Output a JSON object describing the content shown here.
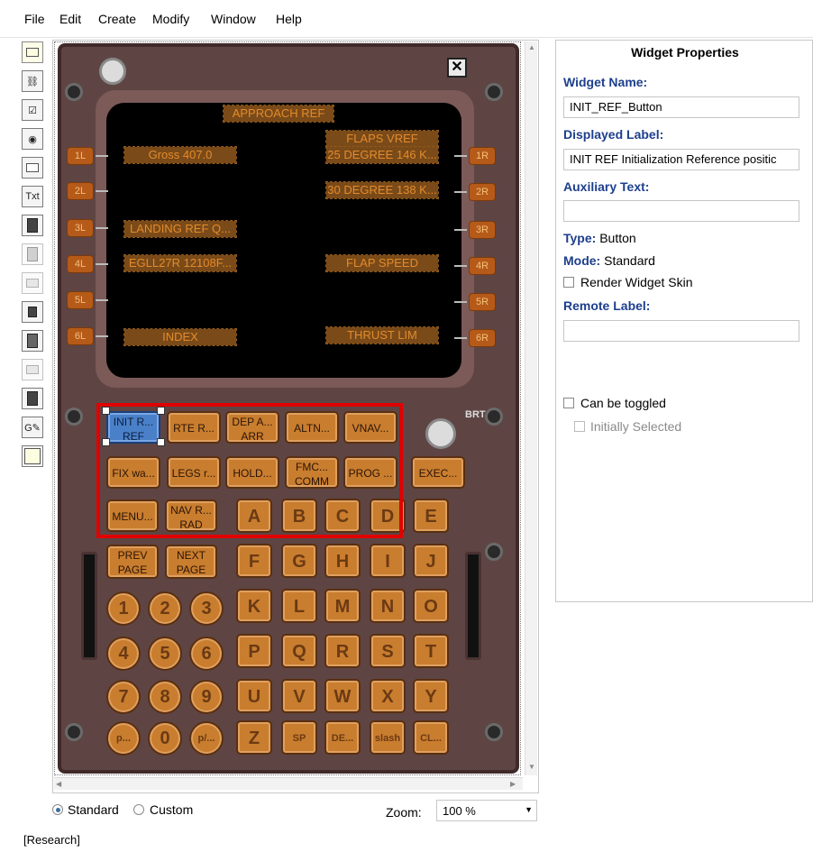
{
  "menu": [
    "File",
    "Edit",
    "Create",
    "Modify",
    "Window",
    "Help"
  ],
  "toolbar_icons": [
    "widget-rect-icon",
    "link-icon",
    "checkbox-icon",
    "radio-icon",
    "frame-icon",
    "text-icon",
    "panel-icon",
    "disabled-icon-1",
    "disabled-icon-2",
    "copy-icon",
    "document-icon",
    "disabled-icon-3",
    "dark-panel-icon",
    "graphic-edit-icon",
    "note-icon"
  ],
  "toolbar_text_label": "Txt",
  "fmc": {
    "close_glyph": "✕",
    "brt_label": "BRT",
    "screen": {
      "title": "APPROACH REF",
      "left": [
        "Gross 407.0",
        "",
        "LANDING REF Q...",
        "EGLL27R 12108F...",
        "",
        "INDEX"
      ],
      "right_top": "FLAPS VREF",
      "right": [
        "25 DEGREE 146 K...",
        "30 DEGREE 138 K...",
        "",
        "FLAP SPEED",
        "",
        "THRUST LIM"
      ],
      "lsk_left": [
        "1L",
        "2L",
        "3L",
        "4L",
        "5L",
        "6L"
      ],
      "lsk_right": [
        "1R",
        "2R",
        "3R",
        "4R",
        "5R",
        "6R"
      ]
    },
    "func_row1": [
      "INIT R...",
      "RTE R...",
      "DEP A...",
      "ALTN...",
      "VNAV..."
    ],
    "func_row1_under": [
      "REF",
      "",
      "ARR",
      "",
      ""
    ],
    "func_row2": [
      "FIX wa...",
      "LEGS r...",
      "HOLD...",
      "FMC...",
      "PROG ...",
      "EXEC..."
    ],
    "func_row2_under": [
      "",
      "",
      "",
      "COMM",
      "",
      ""
    ],
    "func_row3": [
      "MENU...",
      "NAV R..."
    ],
    "func_row3_under": [
      "",
      "RAD"
    ],
    "func_row4": [
      "PREV",
      "NEXT"
    ],
    "func_row4_under": [
      "PAGE",
      "PAGE"
    ],
    "letters": [
      "A",
      "B",
      "C",
      "D",
      "E",
      "F",
      "G",
      "H",
      "I",
      "J",
      "K",
      "L",
      "M",
      "N",
      "O",
      "P",
      "Q",
      "R",
      "S",
      "T",
      "U",
      "V",
      "W",
      "X",
      "Y",
      "Z",
      "SP",
      "DE...",
      "slash",
      "CL..."
    ],
    "digits": [
      "1",
      "2",
      "3",
      "4",
      "5",
      "6",
      "7",
      "8",
      "9",
      "p...",
      "0",
      "p/..."
    ]
  },
  "bottom": {
    "standard": "Standard",
    "custom": "Custom",
    "zoom_label": "Zoom:",
    "zoom_value": "100 %"
  },
  "status": "[Research]",
  "props": {
    "title": "Widget Properties",
    "name_label": "Widget Name:",
    "name_value": "INIT_REF_Button",
    "displayed_label": "Displayed Label:",
    "displayed_value": "INIT REF Initialization Reference positic",
    "aux_label": "Auxiliary Text:",
    "aux_value": "",
    "type_label": "Type:",
    "type_value": "Button",
    "mode_label": "Mode:",
    "mode_value": "Standard",
    "render_skin": "Render Widget Skin",
    "remote_label": "Remote Label:",
    "remote_value": "",
    "toggle": "Can be toggled",
    "initially": "Initially Selected"
  }
}
